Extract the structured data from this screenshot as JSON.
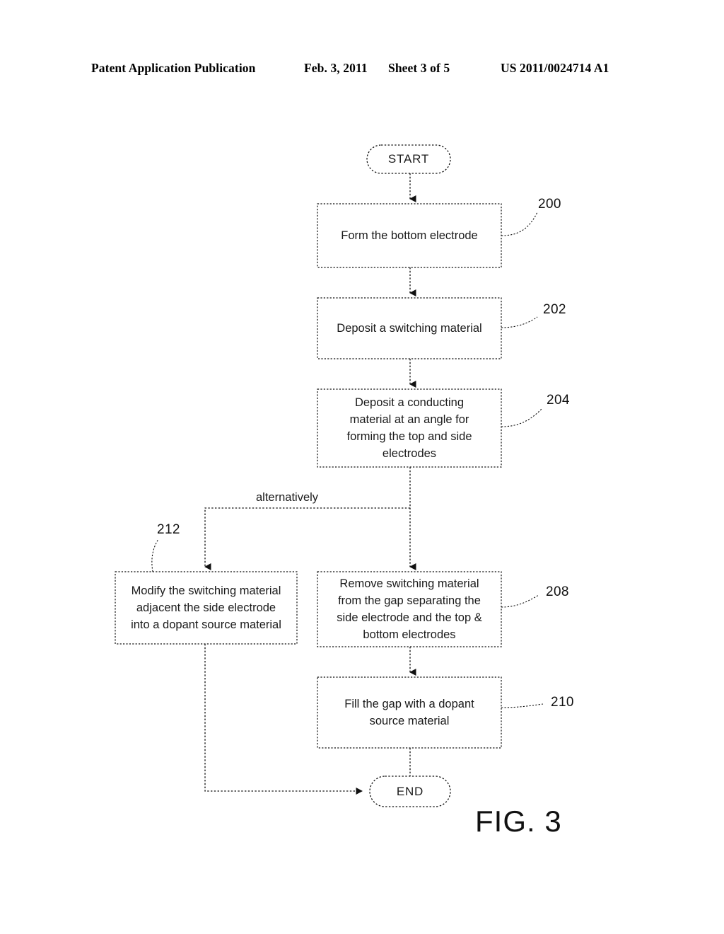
{
  "header": {
    "publication": "Patent Application Publication",
    "date": "Feb. 3, 2011",
    "sheet": "Sheet 3 of 5",
    "patent_number": "US 2011/0024714 A1"
  },
  "figure": {
    "caption": "FIG. 3",
    "line_color": "#000000",
    "line_style": "dotted"
  },
  "flowchart": {
    "start": {
      "label": "START"
    },
    "end": {
      "label": "END"
    },
    "edge_labels": {
      "alternatively": "alternatively"
    },
    "steps": [
      {
        "ref": "200",
        "label": "Form the bottom electrode"
      },
      {
        "ref": "202",
        "label": "Deposit a switching material"
      },
      {
        "ref": "204",
        "label": "Deposit a conducting\nmaterial at an angle for\nforming the top and side\nelectrodes"
      },
      {
        "ref": "208",
        "label": "Remove switching material\nfrom the gap separating the\nside electrode and the top &\nbottom electrodes"
      },
      {
        "ref": "210",
        "label": "Fill the gap with a dopant\nsource material"
      },
      {
        "ref": "212",
        "label": "Modify the switching material\nadjacent the side electrode\ninto a dopant source material"
      }
    ]
  }
}
